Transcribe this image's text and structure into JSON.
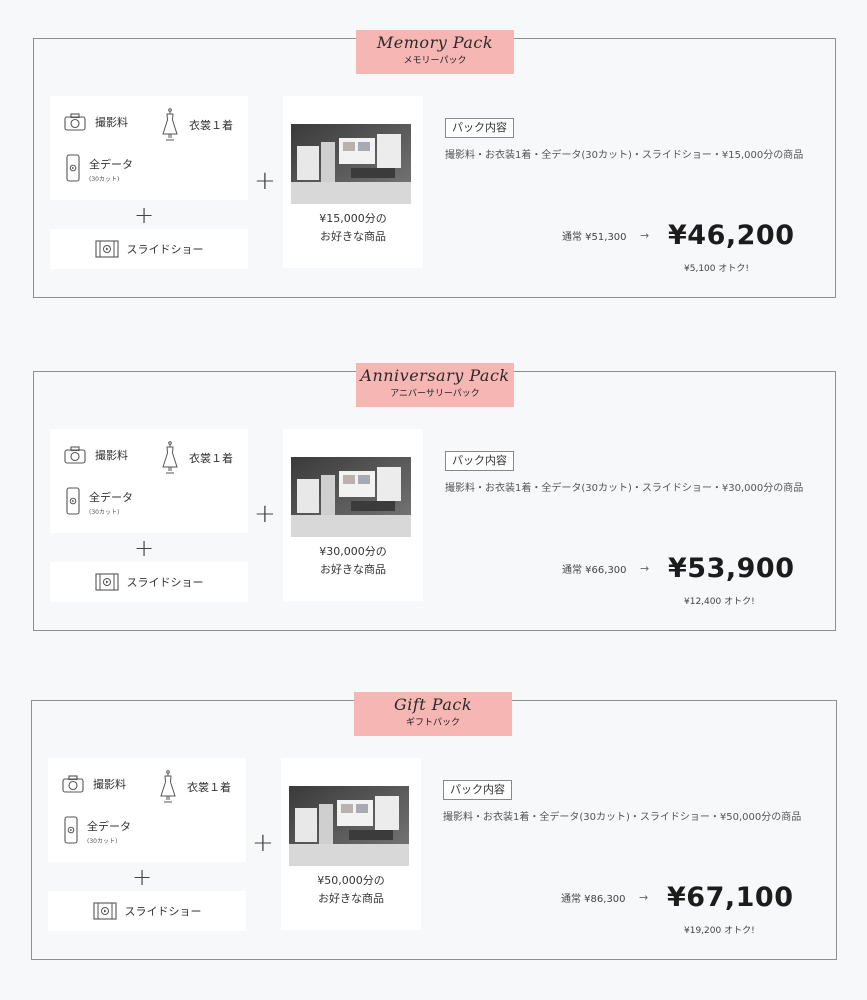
{
  "packs": [
    {
      "script_title": "Memory Pack",
      "kana_title": "メモリーパック",
      "items": {
        "photo": "撮影料",
        "dress": "衣裳１着",
        "data": "全データ",
        "data_sub": "(30カット)",
        "slideshow": "スライドショー"
      },
      "goods_line1": "¥15,000分の",
      "goods_line2": "お好きな商品",
      "content_label": "パック内容",
      "content_text": "撮影料・お衣装1着・全データ(30カット)・スライドショー・¥15,000分の商品",
      "regular": "通常 ¥51,300",
      "arrow": "→",
      "price": "¥46,200",
      "savings": "¥5,100 オトク!"
    },
    {
      "script_title": "Anniversary Pack",
      "kana_title": "アニバーサリーパック",
      "items": {
        "photo": "撮影料",
        "dress": "衣裳１着",
        "data": "全データ",
        "data_sub": "(30カット)",
        "slideshow": "スライドショー"
      },
      "goods_line1": "¥30,000分の",
      "goods_line2": "お好きな商品",
      "content_label": "パック内容",
      "content_text": "撮影料・お衣装1着・全データ(30カット)・スライドショー・¥30,000分の商品",
      "regular": "通常 ¥66,300",
      "arrow": "→",
      "price": "¥53,900",
      "savings": "¥12,400 オトク!"
    },
    {
      "script_title": "Gift Pack",
      "kana_title": "ギフトパック",
      "items": {
        "photo": "撮影料",
        "dress": "衣裳１着",
        "data": "全データ",
        "data_sub": "(30カット)",
        "slideshow": "スライドショー"
      },
      "goods_line1": "¥50,000分の",
      "goods_line2": "お好きな商品",
      "content_label": "パック内容",
      "content_text": "撮影料・お衣装1着・全データ(30カット)・スライドショー・¥50,000分の商品",
      "regular": "通常 ¥86,300",
      "arrow": "→",
      "price": "¥67,100",
      "savings": "¥19,200 オトク!"
    }
  ],
  "icons": {
    "photo": "camera-icon",
    "dress": "dress-icon",
    "data": "smartphone-icon",
    "slideshow": "film-icon"
  },
  "colors": {
    "tag_background": "#f6b7b4",
    "page_background": "#f7f8fa",
    "border": "#8f8f8f"
  }
}
